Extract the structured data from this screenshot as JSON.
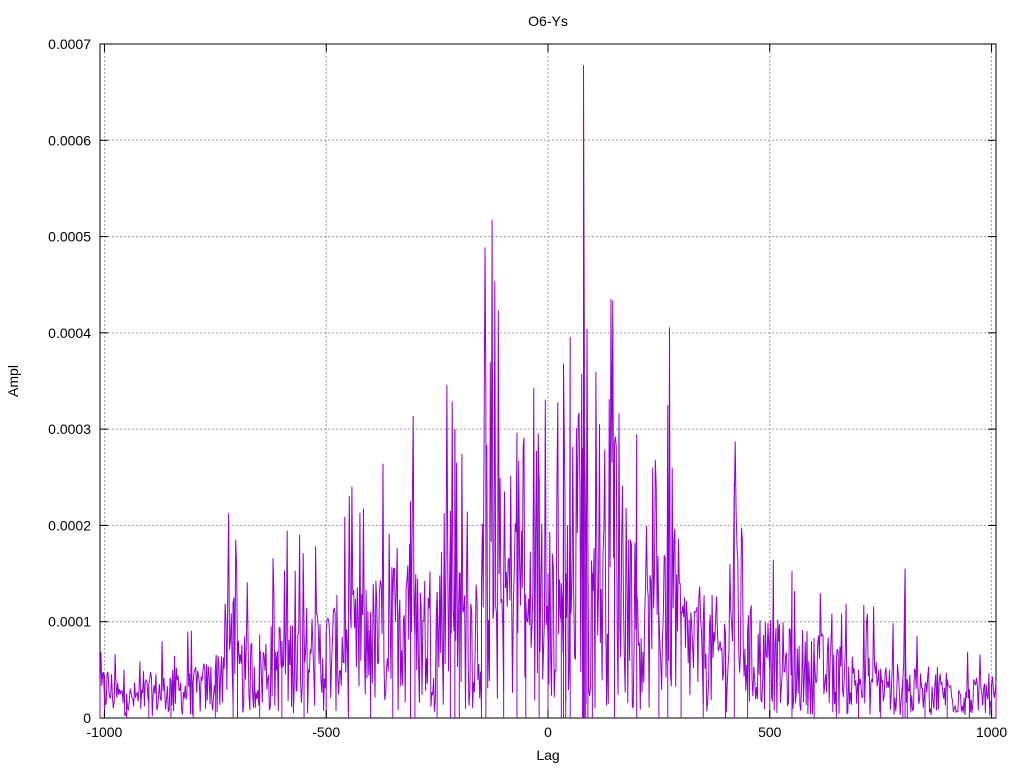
{
  "chart_data": {
    "type": "line",
    "title": "O6-Ys",
    "xlabel": "Lag",
    "ylabel": "Ampl",
    "xlim": [
      -1010,
      1010
    ],
    "ylim": [
      0,
      0.0007
    ],
    "grid": true,
    "x_ticks": [
      {
        "value": -1000,
        "label": "-1000"
      },
      {
        "value": -500,
        "label": "-500"
      },
      {
        "value": 0,
        "label": "0"
      },
      {
        "value": 500,
        "label": "500"
      },
      {
        "value": 1000,
        "label": "1000"
      }
    ],
    "y_ticks": [
      {
        "value": 0,
        "label": "0"
      },
      {
        "value": 0.0001,
        "label": "0.0001"
      },
      {
        "value": 0.0002,
        "label": "0.0002"
      },
      {
        "value": 0.0003,
        "label": "0.0003"
      },
      {
        "value": 0.0004,
        "label": "0.0004"
      },
      {
        "value": 0.0005,
        "label": "0.0005"
      },
      {
        "value": 0.0006,
        "label": "0.0006"
      },
      {
        "value": 0.0007,
        "label": "0.0007"
      }
    ],
    "series": [
      {
        "color": "#9400d3",
        "x": [
          -1010,
          -1000,
          -950,
          -900,
          -850,
          -800,
          -750,
          -710,
          -700,
          -650,
          -600,
          -550,
          -500,
          -450,
          -400,
          -350,
          -310,
          -300,
          -250,
          -220,
          -210,
          -200,
          -150,
          -140,
          -100,
          -70,
          -50,
          -20,
          0,
          30,
          35,
          40,
          50,
          78,
          80,
          82,
          85,
          90,
          100,
          150,
          200,
          250,
          270,
          300,
          350,
          400,
          420,
          450,
          500,
          550,
          600,
          650,
          700,
          750,
          800,
          805,
          810,
          850,
          900,
          950,
          1000,
          1010
        ],
        "y": [
          3e-05,
          4.5e-05,
          2.5e-05,
          3.5e-05,
          4e-05,
          3.8e-05,
          5e-05,
          0.00012,
          6e-05,
          7e-05,
          8e-05,
          9e-05,
          9e-05,
          0.0001,
          0.00011,
          0.00012,
          0.000225,
          0.00012,
          0.00013,
          0.000215,
          0.0003,
          0.00012,
          0.00014,
          0.000272,
          0.00014,
          0.000258,
          0.00012,
          0.00025,
          0.00015,
          0.00014,
          0.000368,
          0.00015,
          0.0002,
          0.00028,
          0.000678,
          0.0003,
          0.00016,
          0.00018,
          0.00015,
          0.000285,
          0.00013,
          0.00011,
          0.00025,
          0.00011,
          0.0001,
          9e-05,
          0.000225,
          9e-05,
          8e-05,
          7e-05,
          7e-05,
          6e-05,
          5e-05,
          5e-05,
          4e-05,
          0.000155,
          4e-05,
          3.5e-05,
          4e-05,
          3e-05,
          3.5e-05,
          3e-05
        ]
      }
    ]
  }
}
